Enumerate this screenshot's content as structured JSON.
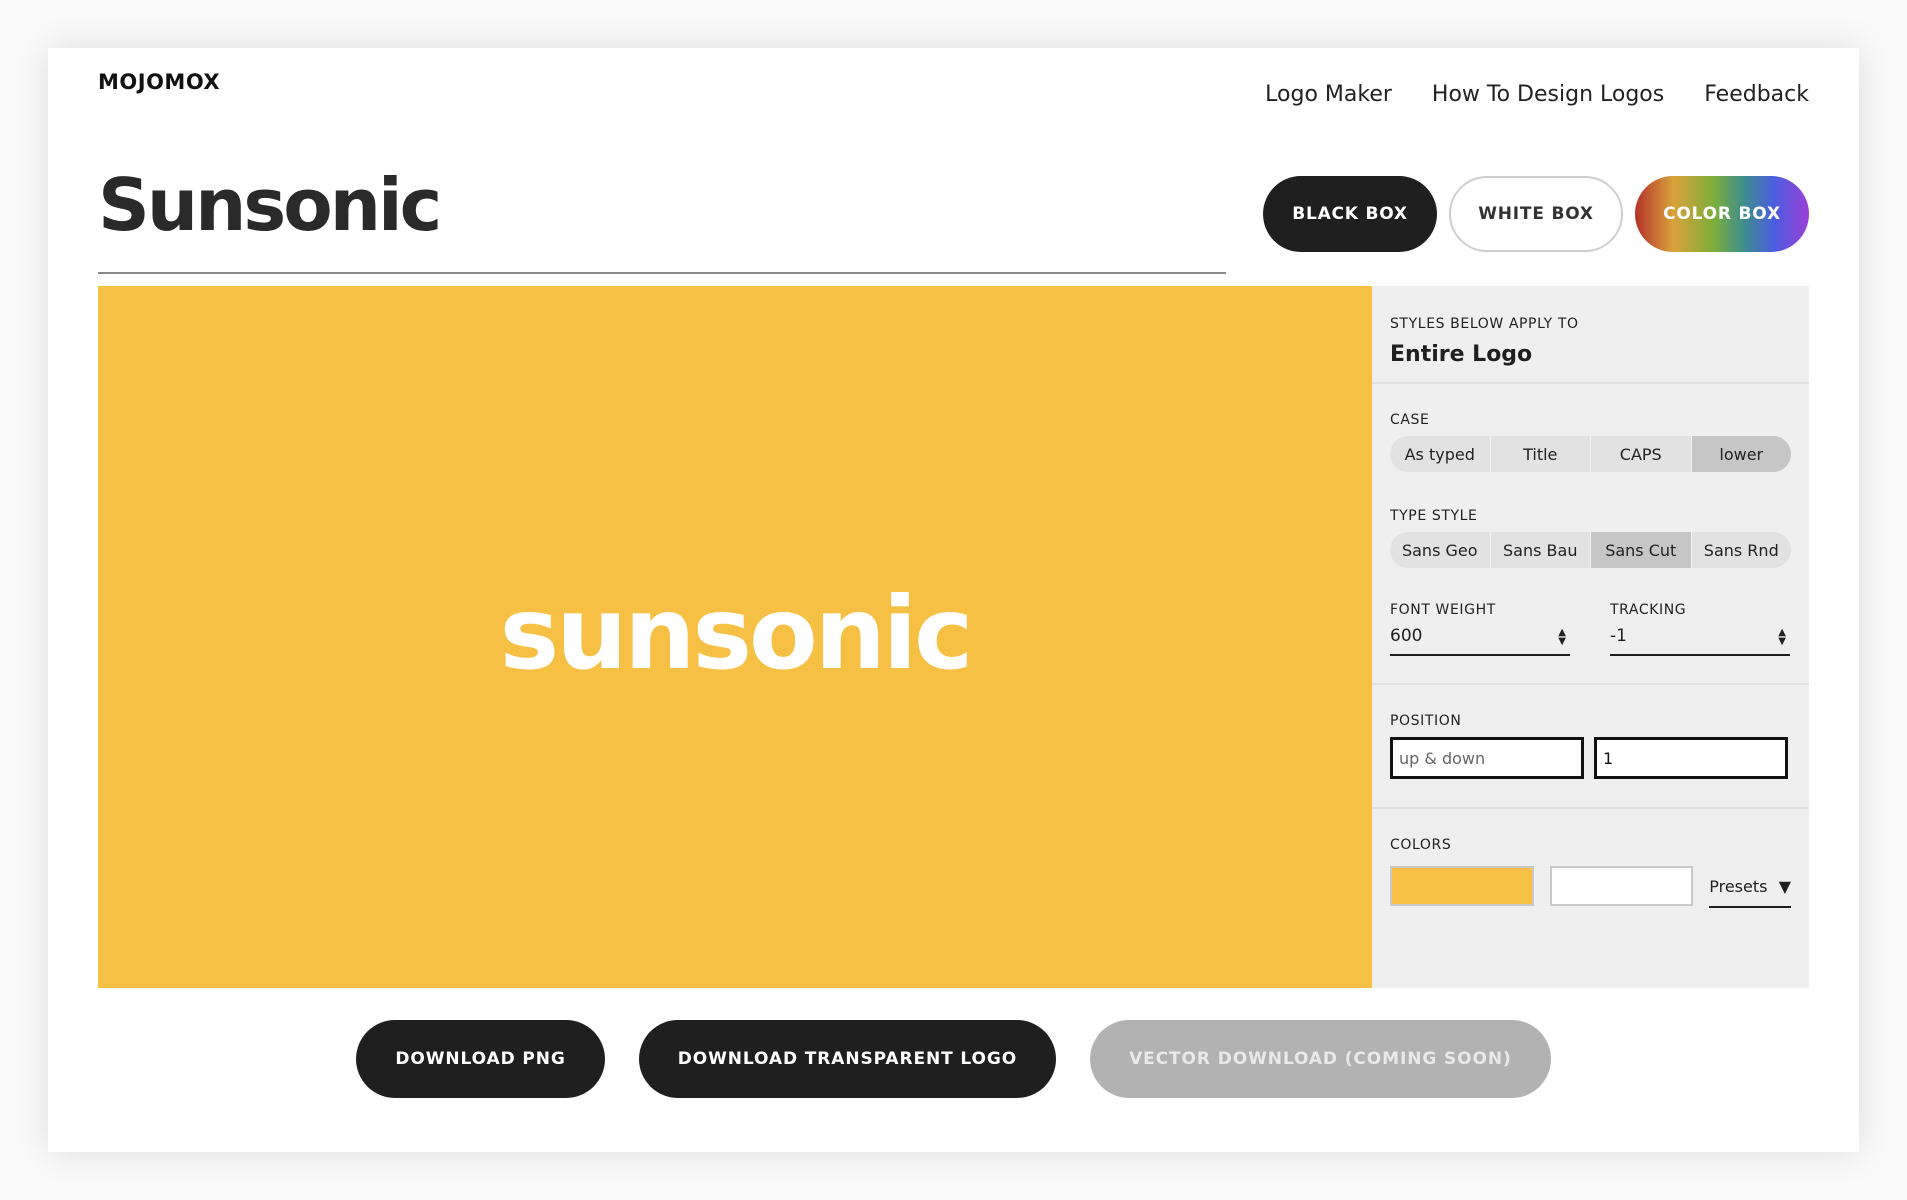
{
  "header": {
    "brand": "MOJOMOX",
    "nav": [
      "Logo Maker",
      "How To Design Logos",
      "Feedback"
    ]
  },
  "logo": {
    "name": "Sunsonic",
    "display_text": "sunsonic"
  },
  "box_buttons": {
    "black": "BLACK BOX",
    "white": "WHITE BOX",
    "color": "COLOR BOX"
  },
  "canvas": {
    "background": "#F5C044",
    "text_color": "#FFFFFF"
  },
  "panel": {
    "apply_label": "STYLES BELOW APPLY TO",
    "apply_target": "Entire Logo",
    "case": {
      "label": "CASE",
      "options": [
        "As typed",
        "Title",
        "CAPS",
        "lower"
      ],
      "selected": "lower"
    },
    "type_style": {
      "label": "TYPE STYLE",
      "options": [
        "Sans Geo",
        "Sans Bau",
        "Sans Cut",
        "Sans Rnd"
      ],
      "selected": "Sans Cut"
    },
    "font_weight": {
      "label": "FONT WEIGHT",
      "value": "600"
    },
    "tracking": {
      "label": "TRACKING",
      "value": "-1"
    },
    "position": {
      "label": "POSITION",
      "placeholder": "up & down",
      "value": "1"
    },
    "colors": {
      "label": "COLORS",
      "swatch_1": "#F5C044",
      "swatch_2": "#FFFFFF",
      "presets_label": "Presets"
    }
  },
  "downloads": {
    "png": "DOWNLOAD PNG",
    "transparent": "DOWNLOAD TRANSPARENT LOGO",
    "vector": "VECTOR DOWNLOAD (COMING SOON)"
  }
}
